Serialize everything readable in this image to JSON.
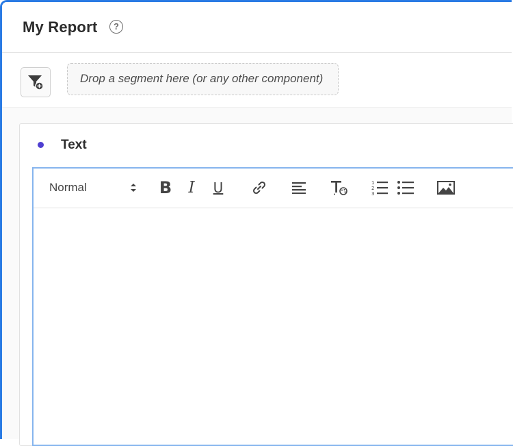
{
  "header": {
    "title": "My Report",
    "help_icon": "help-icon",
    "help_glyph": "?"
  },
  "segment_bar": {
    "filter_icon": "filter-add-icon",
    "dropzone_text": "Drop a segment here (or any other component)"
  },
  "panel": {
    "title": "Text",
    "dot_color": "#4f3fd1"
  },
  "editor": {
    "format_value": "Normal",
    "tools": {
      "bold_label": "B",
      "italic_label": "I",
      "underline_label": "U",
      "link_icon": "link-icon",
      "align_icon": "align-left-icon",
      "text_color_icon": "text-color-icon",
      "ordered_list_icon": "ordered-list-icon",
      "bullet_list_icon": "bullet-list-icon",
      "image_icon": "image-icon"
    },
    "content": ""
  },
  "colors": {
    "accent": "#2a7be4",
    "editor_border": "#86b5ee"
  }
}
